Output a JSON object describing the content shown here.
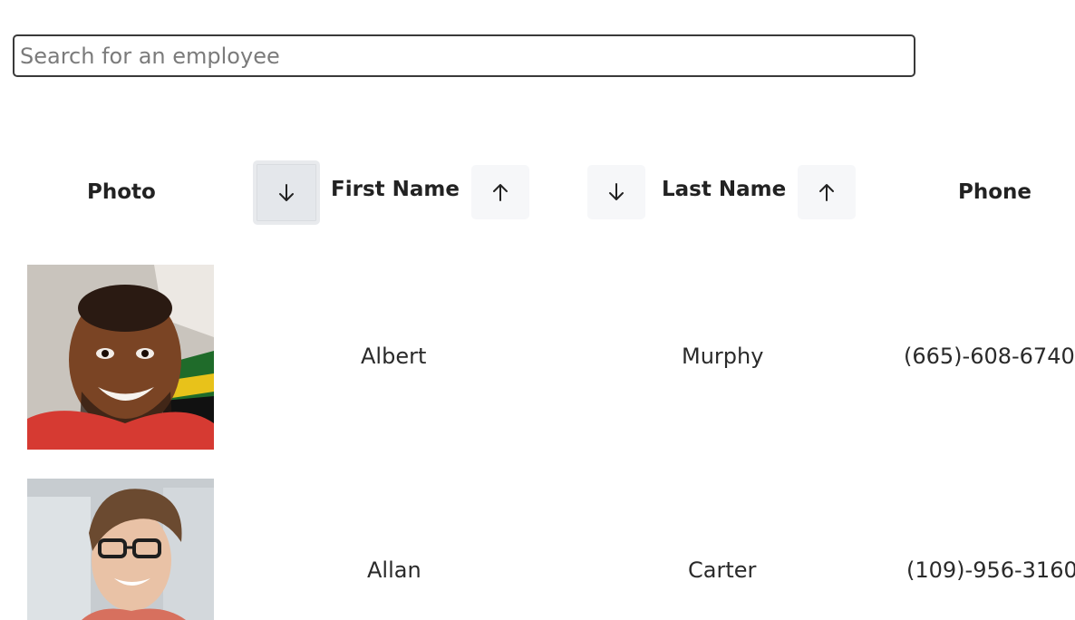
{
  "search": {
    "placeholder": "Search for an employee",
    "value": ""
  },
  "table": {
    "headers": {
      "photo": "Photo",
      "first_name": "First Name",
      "last_name": "Last Name",
      "phone": "Phone"
    },
    "sort_buttons": {
      "descending_icon": "arrow-down-icon",
      "ascending_icon": "arrow-up-icon",
      "active": "first-name-descending"
    },
    "rows": [
      {
        "first_name": "Albert",
        "last_name": "Murphy",
        "phone": "(665)-608-6740"
      },
      {
        "first_name": "Allan",
        "last_name": "Carter",
        "phone": "(109)-956-3160"
      }
    ]
  },
  "colors": {
    "sort_button_bg": "#f6f7f9",
    "sort_button_active_bg": "#e4e7eb",
    "search_border": "#3a3a3a"
  }
}
